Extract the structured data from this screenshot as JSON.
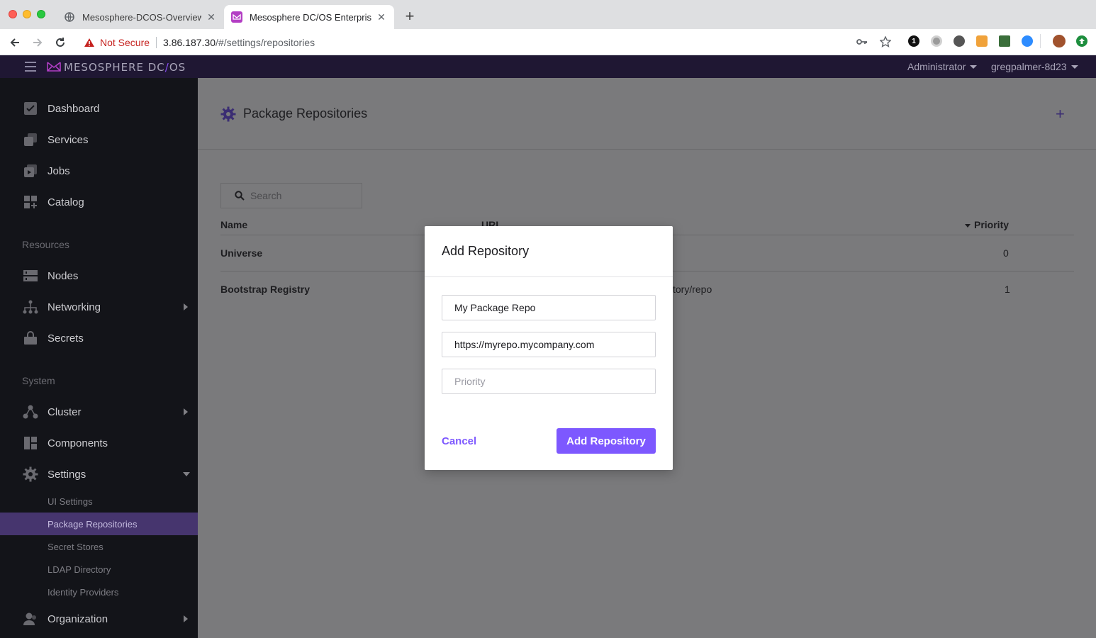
{
  "browser": {
    "tabs": [
      {
        "title": "Mesosphere-DCOS-Overview.p",
        "close": "✕"
      },
      {
        "title": "Mesosphere DC/OS Enterprise",
        "close": "✕"
      }
    ],
    "new_tab": "+",
    "security_label": "Not Secure",
    "url_host": "3.86.187.30",
    "url_path": "/#/settings/repositories",
    "extension_badge": "1"
  },
  "app": {
    "brand_left": "MESOSPHERE DC",
    "brand_slash": "/",
    "brand_right": "OS",
    "role_menu": "Administrator",
    "user_menu": "gregpalmer-8d23"
  },
  "sidebar": {
    "primary": [
      {
        "label": "Dashboard",
        "icon": "dashboard-icon"
      },
      {
        "label": "Services",
        "icon": "services-icon"
      },
      {
        "label": "Jobs",
        "icon": "jobs-icon"
      },
      {
        "label": "Catalog",
        "icon": "catalog-icon"
      }
    ],
    "resources_heading": "Resources",
    "resources": [
      {
        "label": "Nodes",
        "icon": "nodes-icon"
      },
      {
        "label": "Networking",
        "icon": "networking-icon"
      },
      {
        "label": "Secrets",
        "icon": "secrets-icon"
      }
    ],
    "system_heading": "System",
    "system": [
      {
        "label": "Cluster",
        "icon": "cluster-icon"
      },
      {
        "label": "Components",
        "icon": "components-icon"
      },
      {
        "label": "Settings",
        "icon": "settings-icon"
      }
    ],
    "settings_sub": [
      "UI Settings",
      "Package Repositories",
      "Secret Stores",
      "LDAP Directory",
      "Identity Providers"
    ],
    "organization": "Organization"
  },
  "page": {
    "title": "Package Repositories",
    "search_placeholder": "Search",
    "columns": {
      "name": "Name",
      "uri": "URI",
      "priority": "Priority"
    },
    "rows": [
      {
        "name": "Universe",
        "uri": "",
        "priority": "0"
      },
      {
        "name": "Bootstrap Registry",
        "uri": "tory/repo",
        "priority": "1"
      }
    ]
  },
  "modal": {
    "title": "Add Repository",
    "name_value": "My Package Repo",
    "url_value": "https://myrepo.mycompany.com",
    "priority_placeholder": "Priority",
    "cancel_label": "Cancel",
    "submit_label": "Add Repository"
  },
  "colors": {
    "accent": "#7d58ff",
    "header_bg": "#1f1733",
    "sidebar_bg": "#131419",
    "active_item_bg": "#46356e"
  }
}
